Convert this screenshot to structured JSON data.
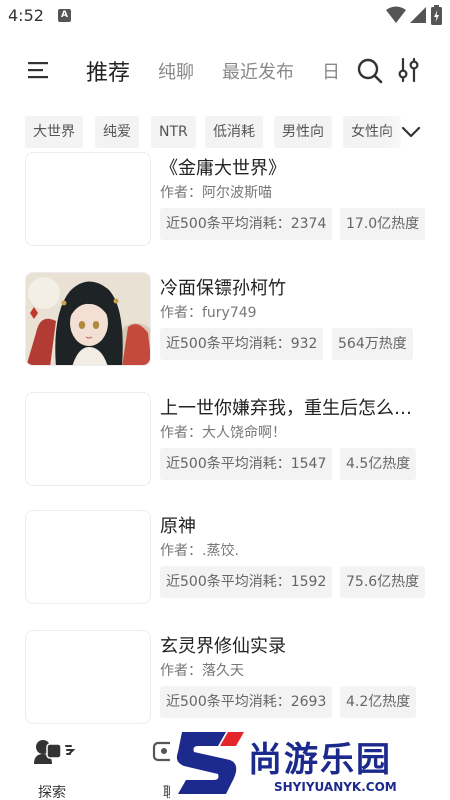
{
  "status_bar": {
    "time": "4:52",
    "indicator_letter": "A"
  },
  "top_nav": {
    "tabs": [
      {
        "label": "推荐",
        "active": true
      },
      {
        "label": "纯聊",
        "active": false
      },
      {
        "label": "最近发布",
        "active": false
      },
      {
        "label": "日",
        "active": false
      }
    ],
    "icons": [
      "menu-icon",
      "search-icon",
      "filter-sliders-icon"
    ]
  },
  "tags": [
    "大世界",
    "纯爱",
    "NTR",
    "低消耗",
    "男性向",
    "女性向"
  ],
  "list": [
    {
      "title": "《金庸大世界》",
      "author": "作者：阿尔波斯喵",
      "consumption": "近500条平均消耗：2374",
      "heat": "17.0亿热度",
      "has_cover": false
    },
    {
      "title": "冷面保镖孙柯竹",
      "author": "作者：fury749",
      "consumption": "近500条平均消耗：932",
      "heat": "564万热度",
      "has_cover": true
    },
    {
      "title": "上一世你嫌弃我，重生后怎么…",
      "author": "作者：大人饶命啊！",
      "consumption": "近500条平均消耗：1547",
      "heat": "4.5亿热度",
      "has_cover": false
    },
    {
      "title": "原神",
      "author": "作者：.蒸饺.",
      "consumption": "近500条平均消耗：1592",
      "heat": "75.6亿热度",
      "has_cover": false
    },
    {
      "title": "玄灵界修仙实录",
      "author": "作者：落久天",
      "consumption": "近500条平均消耗：2693",
      "heat": "4.2亿热度",
      "has_cover": false
    }
  ],
  "bottom_nav": [
    {
      "label": "探索"
    },
    {
      "label": "聊"
    }
  ],
  "watermark": {
    "main": "尚游乐园",
    "sub": "SHYIYUANYK.COM"
  },
  "colors": {
    "watermark_blue": "#1b2a8c",
    "watermark_red": "#e3262b",
    "tag_bg": "#f3f3f3"
  }
}
